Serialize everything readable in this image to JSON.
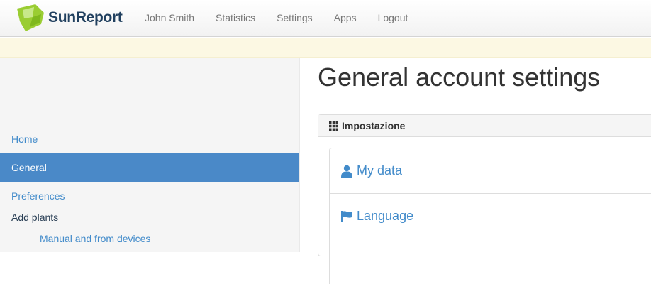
{
  "brand": {
    "name": "SunReport",
    "logo_color": "#9acd32"
  },
  "nav": {
    "items": [
      {
        "label": "John Smith"
      },
      {
        "label": "Statistics"
      },
      {
        "label": "Settings"
      },
      {
        "label": "Apps"
      },
      {
        "label": "Logout"
      }
    ]
  },
  "sidebar": {
    "items": [
      {
        "label": "Home"
      },
      {
        "label": "General",
        "active": true
      },
      {
        "label": "Preferences"
      },
      {
        "label": "Add plants"
      },
      {
        "label": "Manual and from devices"
      }
    ]
  },
  "main": {
    "title": "General account settings",
    "panel": {
      "heading": "Impostazione",
      "heading_icon": "grid-icon",
      "items": [
        {
          "label": "My data",
          "icon": "user-icon"
        },
        {
          "label": "Language",
          "icon": "flag-icon"
        }
      ]
    }
  },
  "colors": {
    "accent": "#428bca",
    "active_bg": "#4a89c8",
    "alert_bg": "#fcf8e3"
  }
}
